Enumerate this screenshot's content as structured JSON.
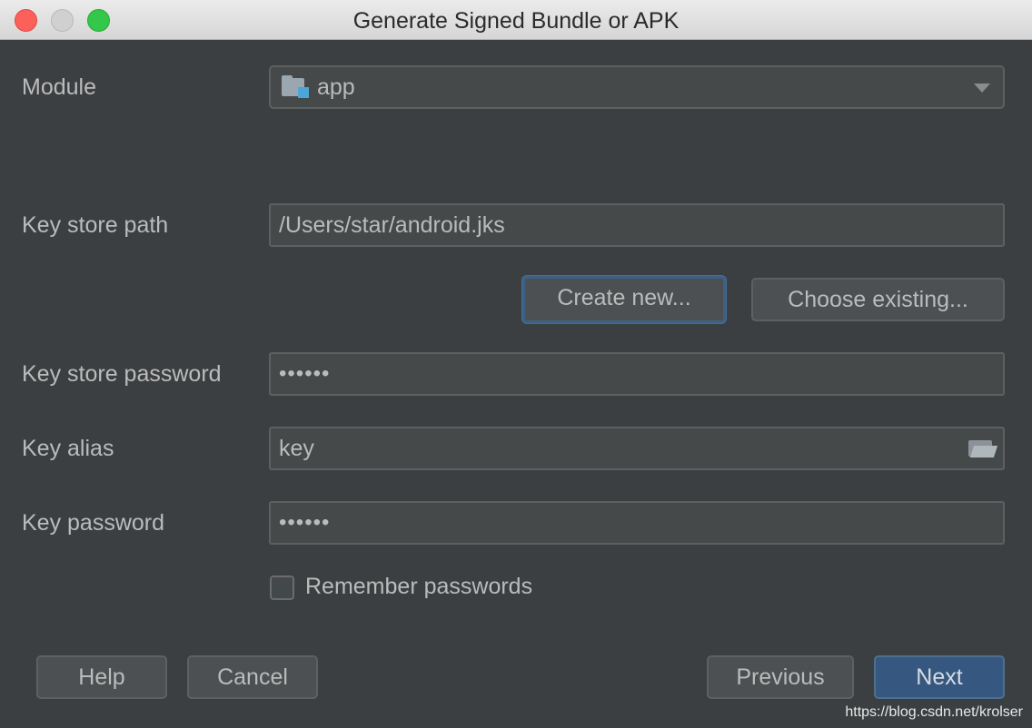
{
  "window": {
    "title": "Generate Signed Bundle or APK"
  },
  "module": {
    "label": "Module",
    "value": "app"
  },
  "keystore": {
    "path_label": "Key store path",
    "path_value": "/Users/star/android.jks",
    "create_new_label": "Create new...",
    "choose_existing_label": "Choose existing...",
    "password_label": "Key store password",
    "password_value": "••••••"
  },
  "key": {
    "alias_label": "Key alias",
    "alias_value": "key",
    "password_label": "Key password",
    "password_value": "••••••"
  },
  "remember": {
    "label": "Remember passwords",
    "checked": false
  },
  "buttons": {
    "help": "Help",
    "cancel": "Cancel",
    "previous": "Previous",
    "next": "Next"
  },
  "watermark": "https://blog.csdn.net/krolser",
  "colors": {
    "background": "#3c3f41",
    "primary_button": "#365880",
    "focus_ring": "#3d6185"
  }
}
